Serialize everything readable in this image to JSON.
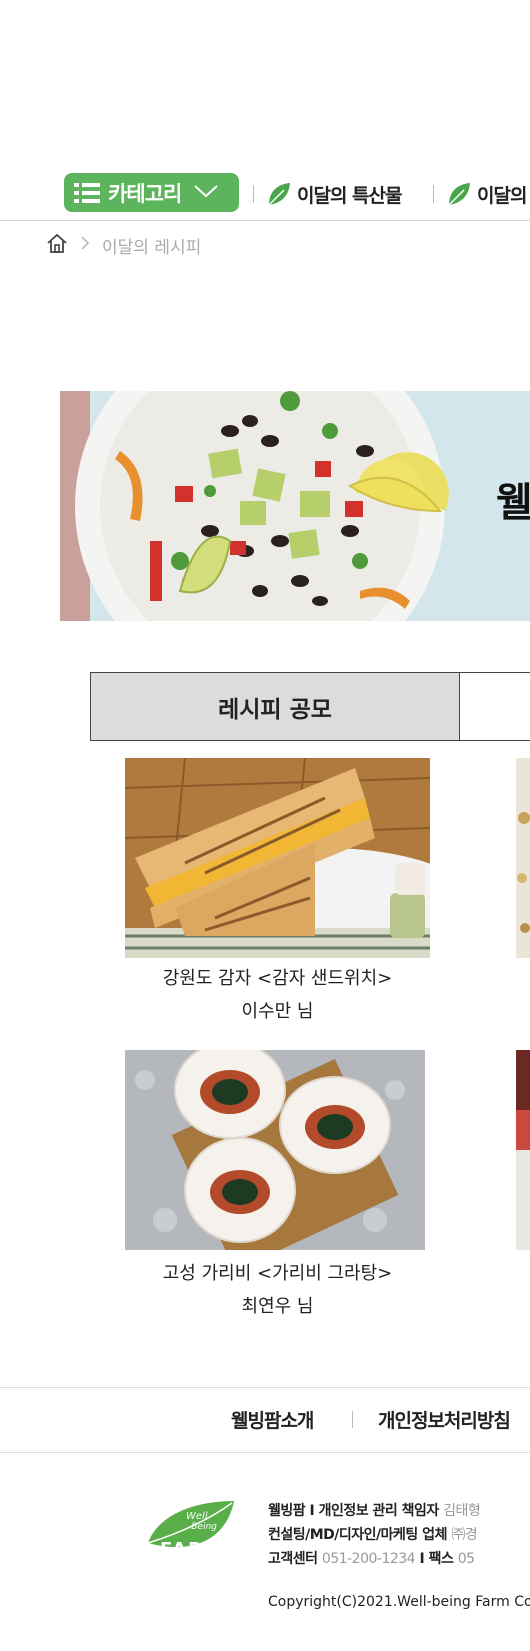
{
  "nav": {
    "category_label": "카테고리",
    "items": [
      {
        "label": "이달의 특산물"
      },
      {
        "label": "이달의"
      }
    ],
    "accent_color": "#5cb45d"
  },
  "breadcrumb": {
    "current": "이달의 레시피"
  },
  "banner": {
    "title_fragment": "웰"
  },
  "tabs": {
    "active_label": "레시피 공모"
  },
  "recipes": [
    {
      "title": "강원도 감자 <감자 샌드위치>",
      "author": "이수만 님"
    },
    {
      "title": "고성 가리비 <가리비 그라탕>",
      "author": "최연우 님"
    }
  ],
  "footer": {
    "links": [
      "웰빙팜소개",
      "개인정보처리방침"
    ],
    "logo": {
      "line1": "Well",
      "line2": "-Being",
      "line3": "FARM"
    },
    "info": {
      "line1_label_a": "웰빙팜",
      "sep": "I",
      "line1_label_b": "개인정보 관리 책임자",
      "line1_value": "김태형",
      "line2_label": "컨설팅/MD/디자인/마케팅 업체",
      "line2_value": "㈜경",
      "line3_label_a": "고객센터",
      "line3_value_a": "051-200-1234",
      "line3_label_b": "팩스",
      "line3_value_b": "05"
    },
    "copyright": "Copyright(C)2021.Well-being Farm Co"
  }
}
